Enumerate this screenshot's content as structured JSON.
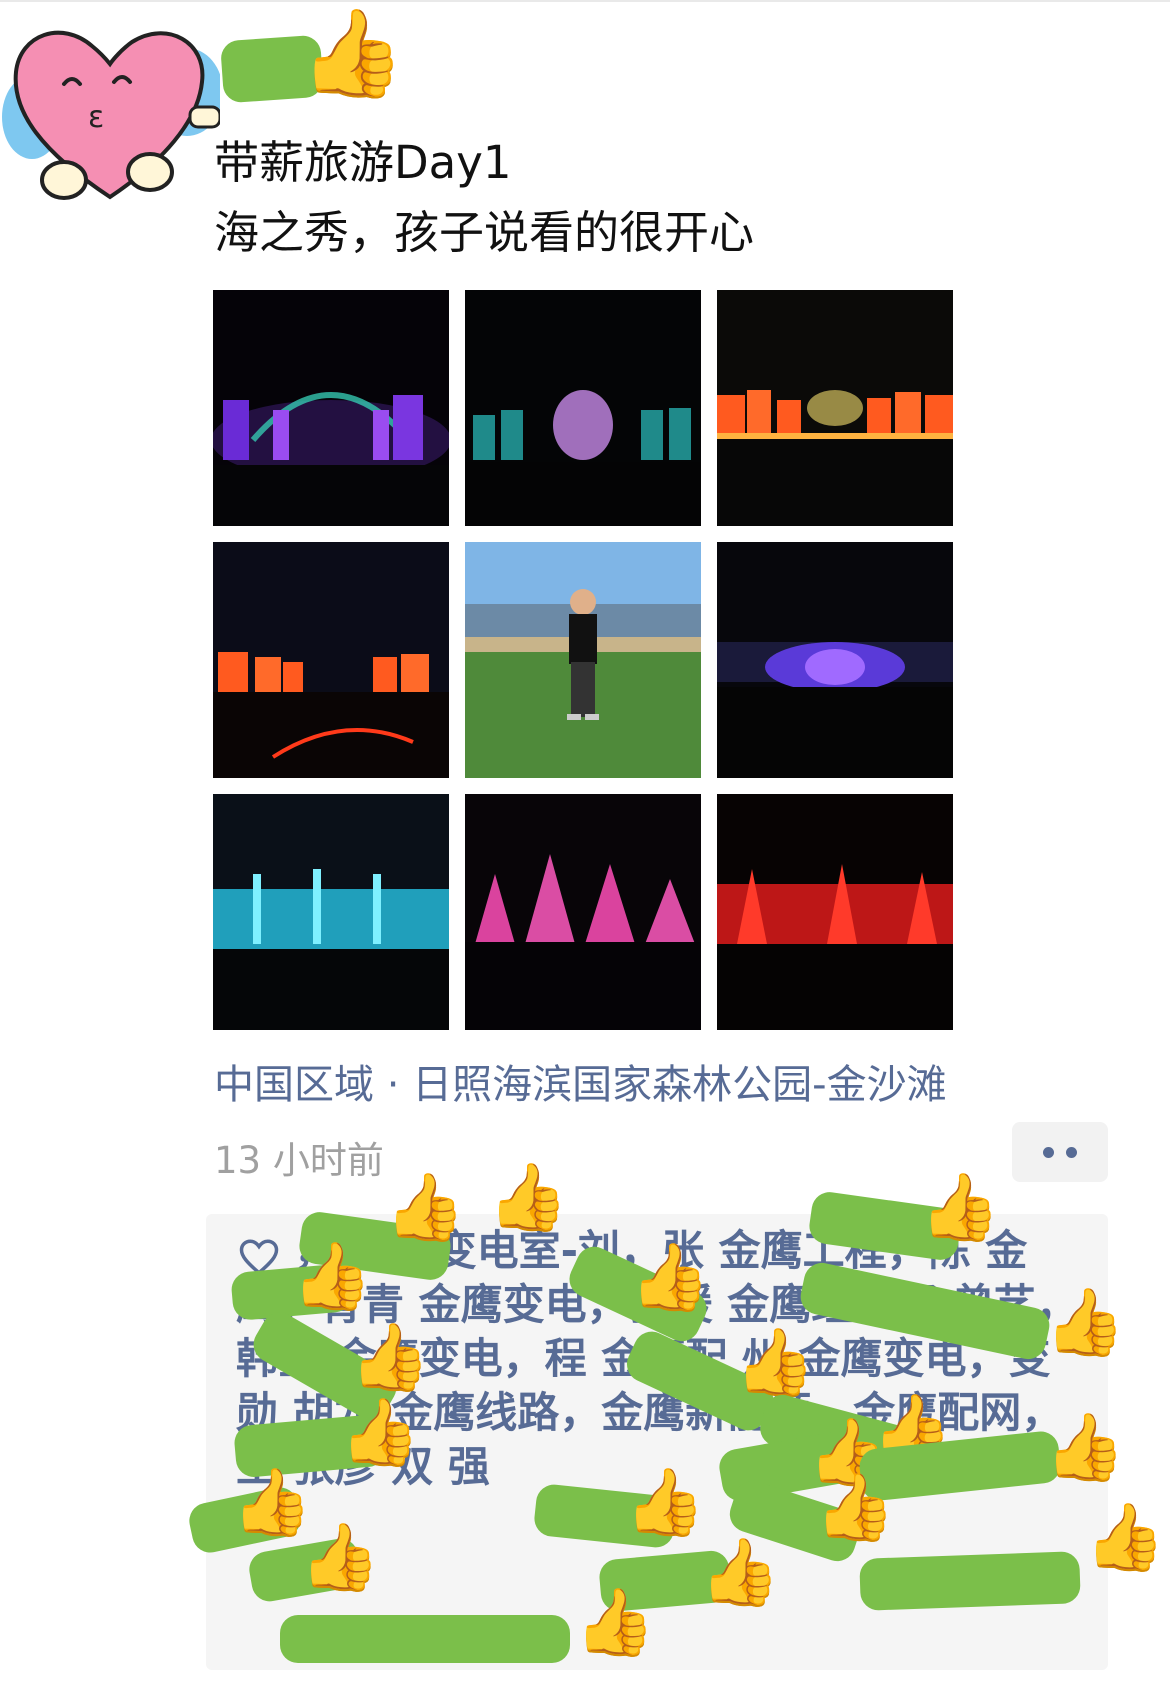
{
  "post": {
    "line1": "带薪旅游Day1",
    "line2": "海之秀，孩子说看的很开心",
    "photos": [
      {
        "name": "night-light-show-purple-arch"
      },
      {
        "name": "night-light-show-teal-figure"
      },
      {
        "name": "night-light-show-orange-sails"
      },
      {
        "name": "night-light-show-orange-sails-crowd"
      },
      {
        "name": "boy-on-beach-grass"
      },
      {
        "name": "night-light-show-blue-stage"
      },
      {
        "name": "fountain-cyan"
      },
      {
        "name": "fountain-pink"
      },
      {
        "name": "fountain-red"
      }
    ],
    "location": "中国区域 · 日照海滨国家森林公园-金沙滩",
    "timestamp": "13 小时前"
  },
  "likes": {
    "icon": "heart-outline-icon",
    "visible_text": "，金鹰 变电室-刘，张 金鹰工程，陈 金鹰，青青 金鹰变电，张媛 金鹰经营部 曾艺，韩星 金鹰变电，程 金鹰配 州 金鹰变电，变 勋 胡龙 金鹰线路，金鹰新能源，金鹰配网，王 张彦 双 强"
  },
  "colors": {
    "link": "#576b95",
    "meta": "#a0a0a0",
    "redaction": "#7bbf4a",
    "thumb": "#f4b400"
  }
}
